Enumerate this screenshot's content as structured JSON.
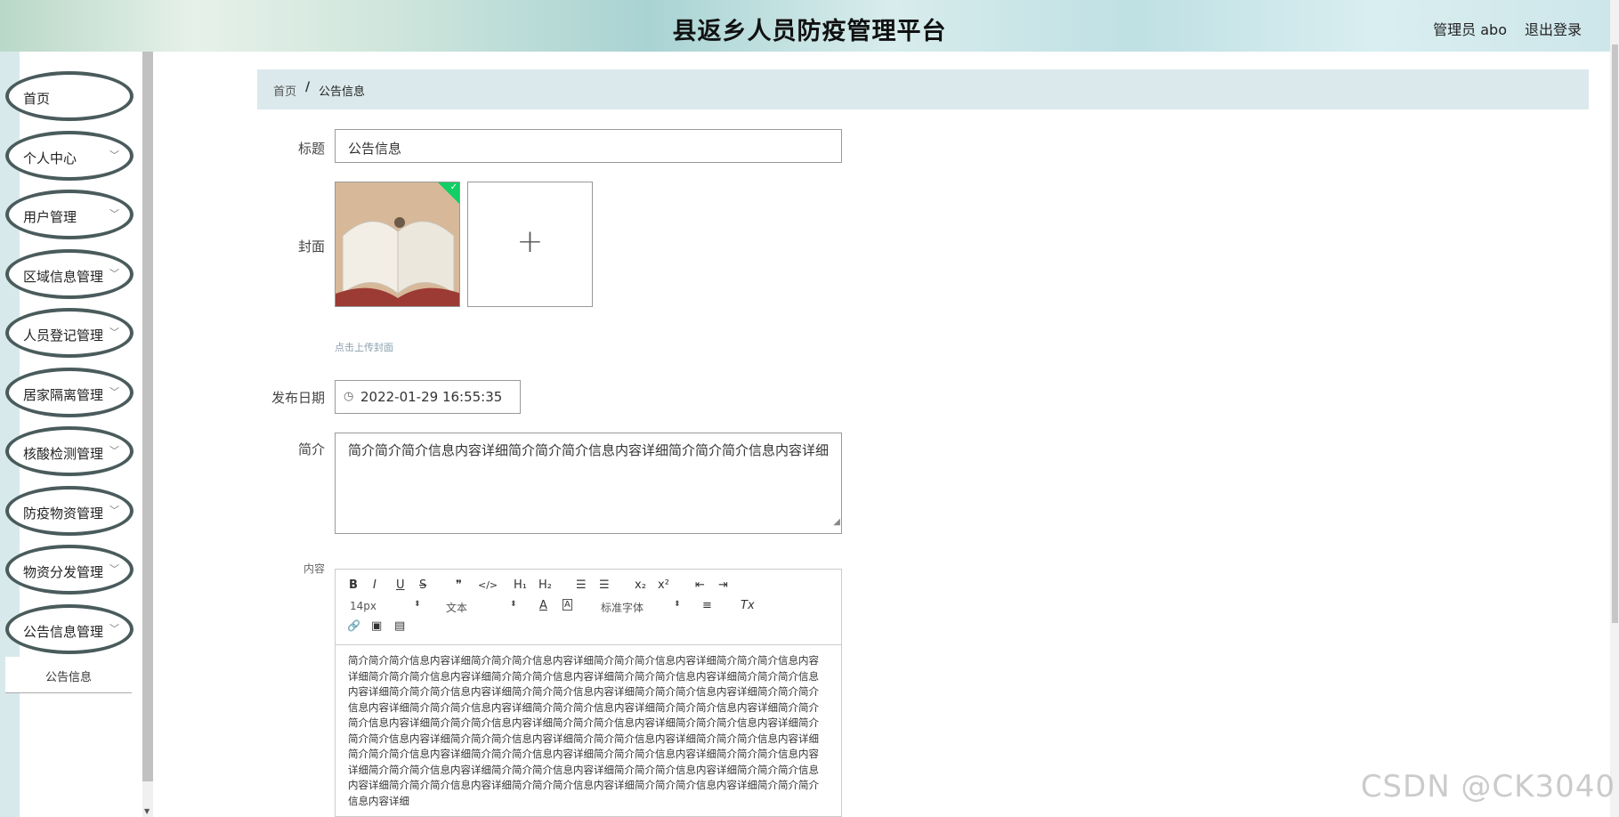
{
  "header": {
    "title": "县返乡人员防疫管理平台",
    "user": "管理员 abo",
    "logout": "退出登录"
  },
  "sidebar": {
    "items": [
      {
        "label": "首页",
        "chevron": ""
      },
      {
        "label": "个人中心",
        "chevron": "﹀"
      },
      {
        "label": "用户管理",
        "chevron": "﹀"
      },
      {
        "label": "区域信息管理",
        "chevron": "﹀"
      },
      {
        "label": "人员登记管理",
        "chevron": "﹀"
      },
      {
        "label": "居家隔离管理",
        "chevron": "﹀"
      },
      {
        "label": "核酸检测管理",
        "chevron": "﹀"
      },
      {
        "label": "防疫物资管理",
        "chevron": "﹀"
      },
      {
        "label": "物资分发管理",
        "chevron": "﹀"
      },
      {
        "label": "公告信息管理",
        "chevron": "﹀"
      }
    ],
    "submenu": "公告信息"
  },
  "breadcrumb": {
    "home": "首页",
    "sep": "/",
    "current": "公告信息"
  },
  "form": {
    "title_label": "标题",
    "title_value": "公告信息",
    "cover_label": "封面",
    "upload_plus": "+",
    "upload_hint": "点击上传封面",
    "date_label": "发布日期",
    "date_value": "2022-01-29 16:55:35",
    "intro_label": "简介",
    "intro_value": "简介简介简介信息内容详细简介简介简介信息内容详细简介简介简介信息内容详细",
    "content_label": "内容"
  },
  "editor": {
    "bold": "B",
    "italic": "I",
    "underline": "U",
    "strike": "S",
    "quote": "❞",
    "code": "</>",
    "h1": "H₁",
    "h2": "H₂",
    "ol": "☰",
    "ul": "☰",
    "sub": "x₂",
    "sup": "x²",
    "outdent": "⇤",
    "indent": "⇥",
    "size": "14px",
    "format": "文本",
    "font": "标准字体",
    "color": "A",
    "bg": "A",
    "align": "≡",
    "clear": "Tx",
    "link": "🔗",
    "image": "▣",
    "video": "▤",
    "content": "简介简介简介信息内容详细简介简介简介信息内容详细简介简介简介信息内容详细简介简介简介信息内容详细简介简介简介信息内容详细简介简介简介信息内容详细简介简介简介信息内容详细简介简介简介信息内容详细简介简介简介信息内容详细简介简介简介信息内容详细简介简介简介信息内容详细简介简介简介信息内容详细简介简介简介信息内容详细简介简介简介信息内容详细简介简介简介信息内容详细简介简介简介信息内容详细简介简介简介信息内容详细简介简介简介信息内容详细简介简介简介信息内容详细简介简介简介信息内容详细简介简介简介信息内容详细简介简介简介信息内容详细简介简介简介信息内容详细简介简介简介信息内容详细简介简介简介信息内容详细简介简介简介信息内容详细简介简介简介信息内容详细简介简介简介信息内容详细简介简介简介信息内容详细简介简介简介信息内容详细简介简介简介信息内容详细简介简介简介信息内容详细简介简介简介信息内容详细简介简介简介信息内容详细简介简介简介信息内容详细"
  },
  "watermark": "CSDN @CK3040",
  "colors": {
    "accent": "#13ce66",
    "breadcrumb_bg": "#dbe9ec",
    "menu_border": "#4a5b5c"
  }
}
